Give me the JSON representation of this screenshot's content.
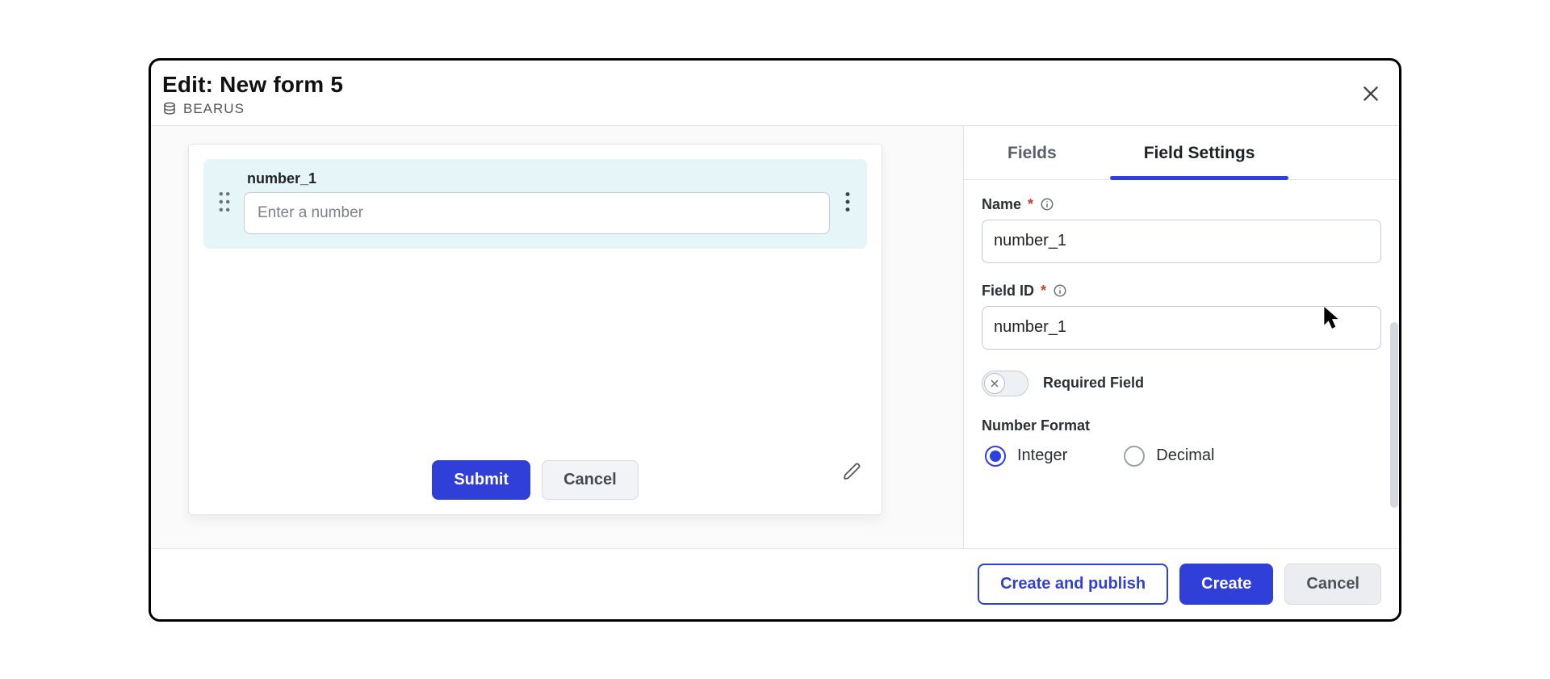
{
  "header": {
    "title": "Edit: New form 5",
    "subtitle": "BEARUS"
  },
  "canvas": {
    "field": {
      "label": "number_1",
      "placeholder": "Enter a number"
    },
    "submit_label": "Submit",
    "cancel_label": "Cancel"
  },
  "sidebar": {
    "tabs": {
      "fields": "Fields",
      "field_settings": "Field Settings"
    },
    "name_label": "Name",
    "name_value": "number_1",
    "field_id_label": "Field ID",
    "field_id_value": "number_1",
    "required_label": "Required Field",
    "required_on": false,
    "number_format_label": "Number Format",
    "radio_integer": "Integer",
    "radio_decimal": "Decimal",
    "number_format_selected": "integer"
  },
  "footer": {
    "create_publish": "Create and publish",
    "create": "Create",
    "cancel": "Cancel"
  }
}
